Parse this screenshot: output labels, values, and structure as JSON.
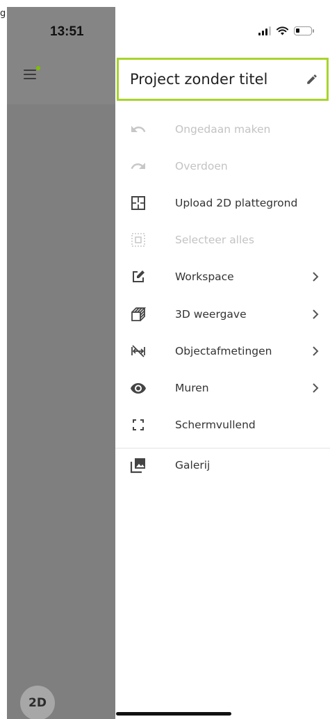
{
  "status_bar": {
    "time": "13:51"
  },
  "stray_char": "g",
  "project": {
    "title": "Project zonder titel"
  },
  "menu": [
    {
      "label": "Ongedaan maken",
      "icon": "undo-icon",
      "enabled": false,
      "submenu": false
    },
    {
      "label": "Overdoen",
      "icon": "redo-icon",
      "enabled": false,
      "submenu": false
    },
    {
      "label": "Upload 2D plattegrond",
      "icon": "floorplan-icon",
      "enabled": true,
      "submenu": false
    },
    {
      "label": "Selecteer alles",
      "icon": "select-all-icon",
      "enabled": false,
      "submenu": false
    },
    {
      "label": "Workspace",
      "icon": "edit-box-icon",
      "enabled": true,
      "submenu": true
    },
    {
      "label": "3D weergave",
      "icon": "cube-icon",
      "enabled": true,
      "submenu": true
    },
    {
      "label": "Objectafmetingen",
      "icon": "dimensions-icon",
      "enabled": true,
      "submenu": true
    },
    {
      "label": "Muren",
      "icon": "eye-icon",
      "enabled": true,
      "submenu": true
    },
    {
      "label": "Schermvullend",
      "icon": "fullscreen-icon",
      "enabled": true,
      "submenu": false
    },
    {
      "label": "Galerij",
      "icon": "gallery-icon",
      "enabled": true,
      "submenu": false
    }
  ],
  "view_toggle": {
    "label": "2D"
  },
  "colors": {
    "accent": "#a8d42c",
    "notification_dot": "#7fbf00",
    "overlay": "#7f7f7f"
  }
}
